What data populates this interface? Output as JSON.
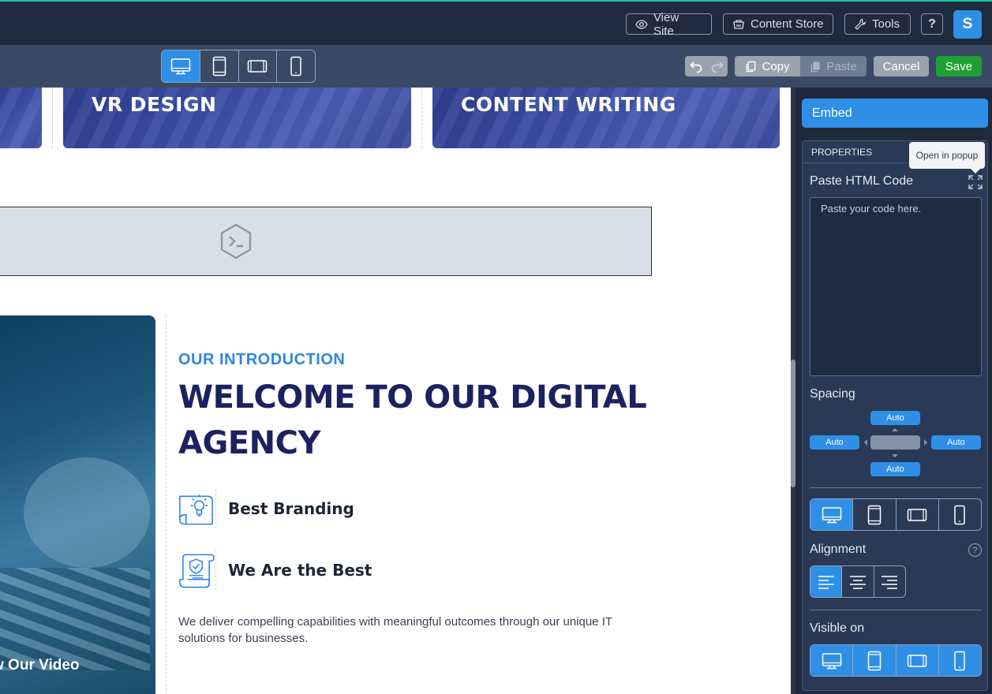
{
  "topbar": {
    "view_site": "View Site",
    "content_store": "Content Store",
    "tools": "Tools",
    "help": "?",
    "avatar_initial": "S",
    "accent": "#19c3a3"
  },
  "toolbar": {
    "copy_label": "Copy",
    "paste_label": "Paste",
    "cancel_label": "Cancel",
    "save_label": "Save",
    "save_color": "#1fa035",
    "active_device": "desktop"
  },
  "canvas": {
    "cards": [
      {
        "title": "VR DESIGN"
      },
      {
        "title": "CONTENT WRITING"
      }
    ],
    "intro": {
      "eyebrow": "OUR INTRODUCTION",
      "headline": "WELCOME TO OUR DIGITAL AGENCY",
      "features": [
        {
          "label": "Best Branding",
          "icon": "lightbulb-blueprint-icon"
        },
        {
          "label": "We Are the Best",
          "icon": "certificate-shield-icon"
        }
      ],
      "paragraph": "We deliver compelling capabilities with meaningful outcomes through our unique IT solutions for businesses."
    },
    "video_label": "w Our Video",
    "embed_placeholder_icon": "terminal-icon"
  },
  "panel": {
    "tab_label": "Embed",
    "properties_label": "PROPERTIES",
    "tooltip": "Open in popup",
    "code_label": "Paste HTML Code",
    "code_placeholder": "Paste your code here.",
    "spacing_label": "Spacing",
    "spacing": {
      "top": "Auto",
      "left": "Auto",
      "right": "Auto",
      "bottom": "Auto"
    },
    "alignment_label": "Alignment",
    "alignment_help": "?",
    "active_alignment": "left",
    "visible_label": "Visible on",
    "accent": "#2f8fe6"
  }
}
